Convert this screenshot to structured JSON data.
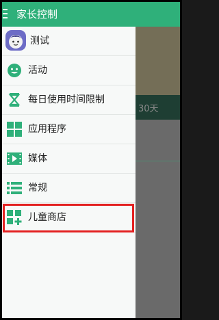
{
  "header": {
    "title": "家长控制",
    "menu_icon": "hamburger-menu-icon"
  },
  "background": {
    "tab_text": "30天"
  },
  "drawer": {
    "items": [
      {
        "label": "测试",
        "icon": "avatar-icon"
      },
      {
        "label": "活动",
        "icon": "activity-face-icon"
      },
      {
        "label": "每日使用时间限制",
        "icon": "hourglass-icon"
      },
      {
        "label": "应用程序",
        "icon": "apps-grid-icon"
      },
      {
        "label": "媒体",
        "icon": "media-play-icon"
      },
      {
        "label": "常规",
        "icon": "list-icon"
      },
      {
        "label": "儿童商店",
        "icon": "store-add-icon"
      }
    ]
  },
  "colors": {
    "accent": "#2fb07a",
    "highlight_border": "#e32020"
  }
}
